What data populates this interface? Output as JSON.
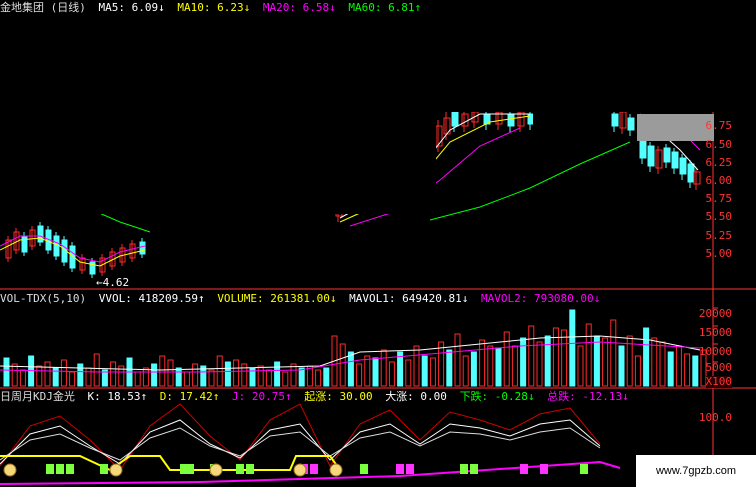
{
  "header_main": {
    "stock_title": "金地集团 (日线)",
    "ma5": "MA5: 6.09↓",
    "ma10": "MA10: 6.23↓",
    "ma20": "MA20: 6.58↓",
    "ma60": "MA60: 6.81↑"
  },
  "header_vol": {
    "indicator": "VOL-TDX(5,10)",
    "vvol": "VVOL: 418209.59↑",
    "volume": "VOLUME: 261381.00↓",
    "mavol1": "MAVOL1: 649420.81↓",
    "mavol2": "MAVOL2: 793080.00↓"
  },
  "header_kdj": {
    "indicator": "日周月KDJ金光",
    "k": "K: 18.53↑",
    "d": "D: 17.42↑",
    "j": "J: 20.75↑",
    "qizhang": "起涨: 30.00",
    "dazhang": "大涨: 0.00",
    "xiadie": "下跌: -0.28↓",
    "zongshi": "总跌: -12.13↓"
  },
  "price_axis": [
    "6.75",
    "6.50",
    "6.25",
    "6.00",
    "5.75",
    "5.50",
    "5.25",
    "5.00"
  ],
  "volume_axis": [
    "20000",
    "15000",
    "10000",
    "5000",
    "X100"
  ],
  "kdj_axis": [
    "100.0"
  ],
  "low_marker": "←4.62",
  "watermark": "www.7gpzb.com",
  "colors": {
    "up": "#ff2a2a",
    "down": "#54ffff",
    "ma5": "#ffffff",
    "ma10": "#ffff00",
    "ma20": "#ff00ff",
    "ma60": "#00ff00",
    "axis": "#ff3333"
  }
}
